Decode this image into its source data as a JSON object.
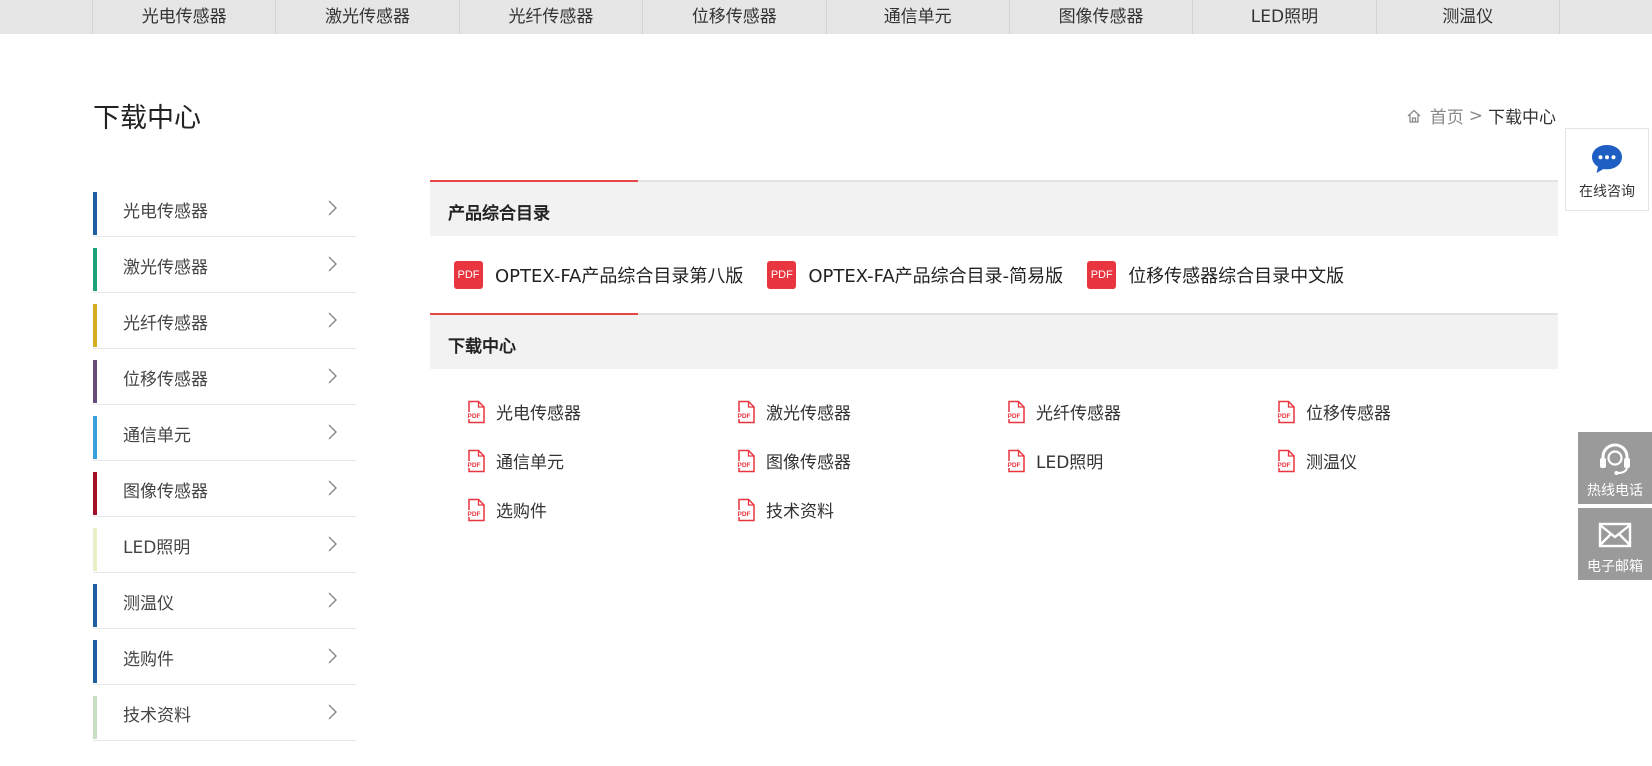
{
  "topnav": {
    "items": [
      "光电传感器",
      "激光传感器",
      "光纤传感器",
      "位移传感器",
      "通信单元",
      "图像传感器",
      "LED照明",
      "测温仪"
    ]
  },
  "page": {
    "title": "下载中心"
  },
  "breadcrumb": {
    "home": "首页",
    "separator": ">",
    "current": "下载中心"
  },
  "sidebar": {
    "items": [
      {
        "label": "光电传感器",
        "color": "#1f5fa0"
      },
      {
        "label": "激光传感器",
        "color": "#1aa37a"
      },
      {
        "label": "光纤传感器",
        "color": "#d4ac1e"
      },
      {
        "label": "位移传感器",
        "color": "#6a4c7a"
      },
      {
        "label": "通信单元",
        "color": "#3aa0dc"
      },
      {
        "label": "图像传感器",
        "color": "#a50f25"
      },
      {
        "label": "LED照明",
        "color": "#e8f0c8"
      },
      {
        "label": "测温仪",
        "color": "#1f5fa0"
      },
      {
        "label": "选购件",
        "color": "#1f5fa0"
      },
      {
        "label": "技术资料",
        "color": "#c8dfc4"
      }
    ]
  },
  "catalog_section": {
    "title": "产品综合目录",
    "badge": "PDF",
    "items": [
      "OPTEX-FA产品综合目录第八版",
      "OPTEX-FA产品综合目录-简易版",
      "位移传感器综合目录中文版"
    ]
  },
  "download_section": {
    "title": "下载中心",
    "items": [
      "光电传感器",
      "激光传感器",
      "光纤传感器",
      "位移传感器",
      "通信单元",
      "图像传感器",
      "LED照明",
      "测温仪",
      "选购件",
      "技术资料"
    ]
  },
  "widgets": {
    "consult": "在线咨询",
    "phone": "热线电话",
    "mail": "电子邮箱"
  },
  "colors": {
    "accent": "#e84545",
    "pdf_red": "#e8353f",
    "widget_gray": "#9a9a9a",
    "chat_blue": "#1f5fc4"
  }
}
